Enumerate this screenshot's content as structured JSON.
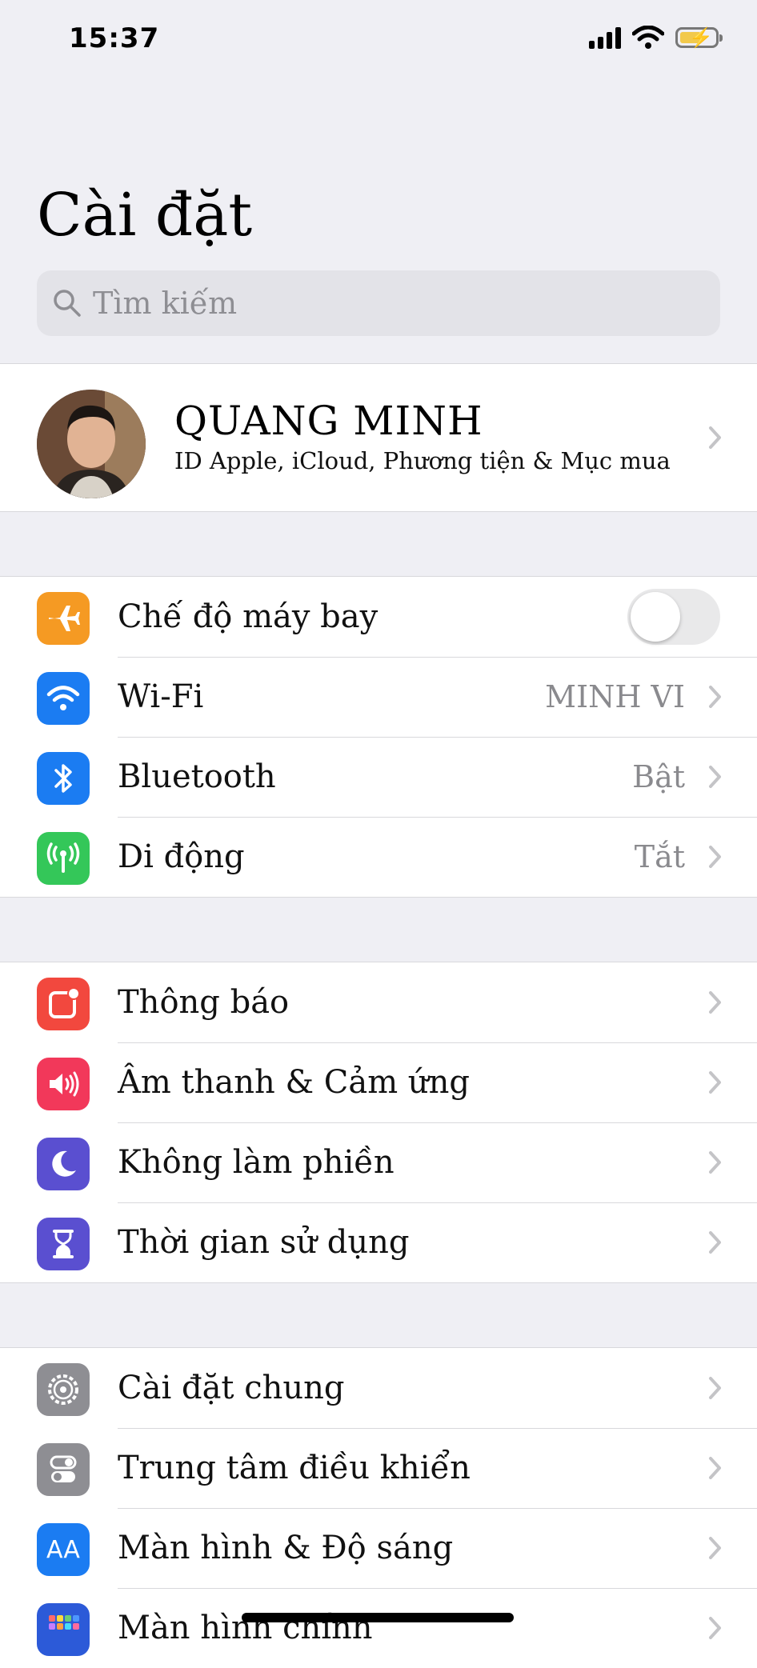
{
  "status": {
    "time": "15:37"
  },
  "title": "Cài đặt",
  "search": {
    "placeholder": "Tìm kiếm"
  },
  "profile": {
    "name": "QUANG MINH",
    "subtitle": "ID Apple, iCloud, Phương tiện & Mục mua"
  },
  "connectivity": {
    "airplane": {
      "label": "Chế độ máy bay",
      "toggle_on": false
    },
    "wifi": {
      "label": "Wi-Fi",
      "value": "MINH VI"
    },
    "bluetooth": {
      "label": "Bluetooth",
      "value": "Bật"
    },
    "cellular": {
      "label": "Di động",
      "value": "Tắt"
    }
  },
  "notifications_group": {
    "notifications": {
      "label": "Thông báo"
    },
    "sounds": {
      "label": "Âm thanh & Cảm ứng"
    },
    "dnd": {
      "label": "Không làm phiền"
    },
    "screentime": {
      "label": "Thời gian sử dụng"
    }
  },
  "general_group": {
    "general": {
      "label": "Cài đặt chung"
    },
    "control_center": {
      "label": "Trung tâm điều khiển"
    },
    "display": {
      "label": "Màn hình & Độ sáng",
      "icon_text": "AA"
    },
    "home_screen": {
      "label": "Màn hình chính"
    }
  },
  "colors": {
    "airplane": "#f59a23",
    "wifi": "#1b7cf2",
    "bluetooth": "#1b7cf2",
    "cellular": "#34c759",
    "notifications": "#f2483e",
    "sounds": "#f2385a",
    "dnd": "#5a4fd0",
    "screentime": "#5a4fd0",
    "general": "#8e8e93",
    "control_center": "#8e8e93",
    "display": "#1b7cf2",
    "home_screen": "#2c5ad8"
  }
}
